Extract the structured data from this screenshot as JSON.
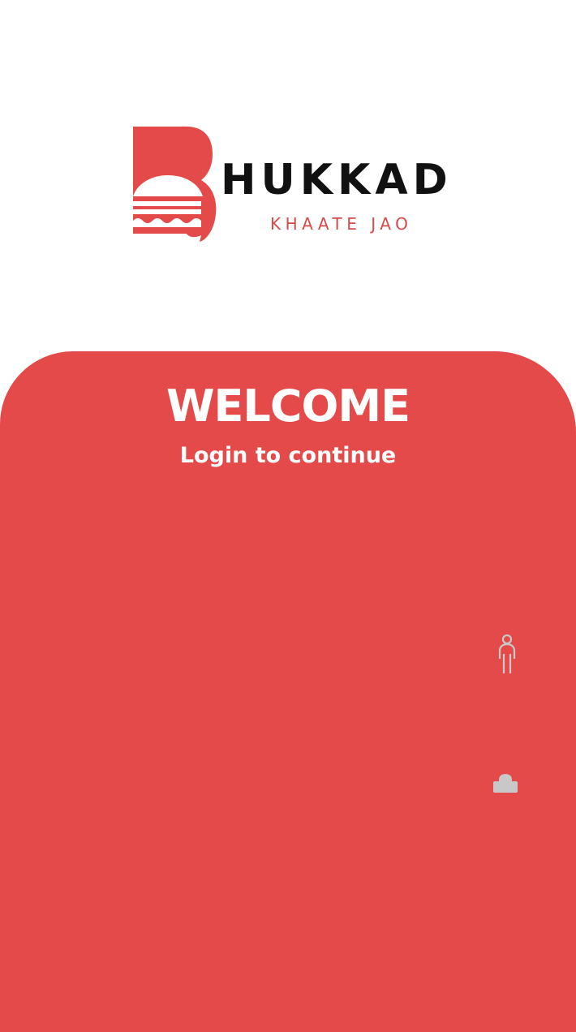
{
  "brand": {
    "name": "HUKKAD",
    "tagline": "KHAATE JAO",
    "logo_icon": "burger-b-logo-icon",
    "accent_color": "#e54a4a",
    "tagline_color": "#d74a4a"
  },
  "login": {
    "title": "WELCOME",
    "subtitle": "Login to continue",
    "panel_color": "#e54a4a"
  },
  "fields": {
    "username": {
      "value": "",
      "placeholder": "",
      "icon": "person-icon"
    },
    "password": {
      "value": "",
      "placeholder": "",
      "icon": "lock-icon"
    }
  }
}
